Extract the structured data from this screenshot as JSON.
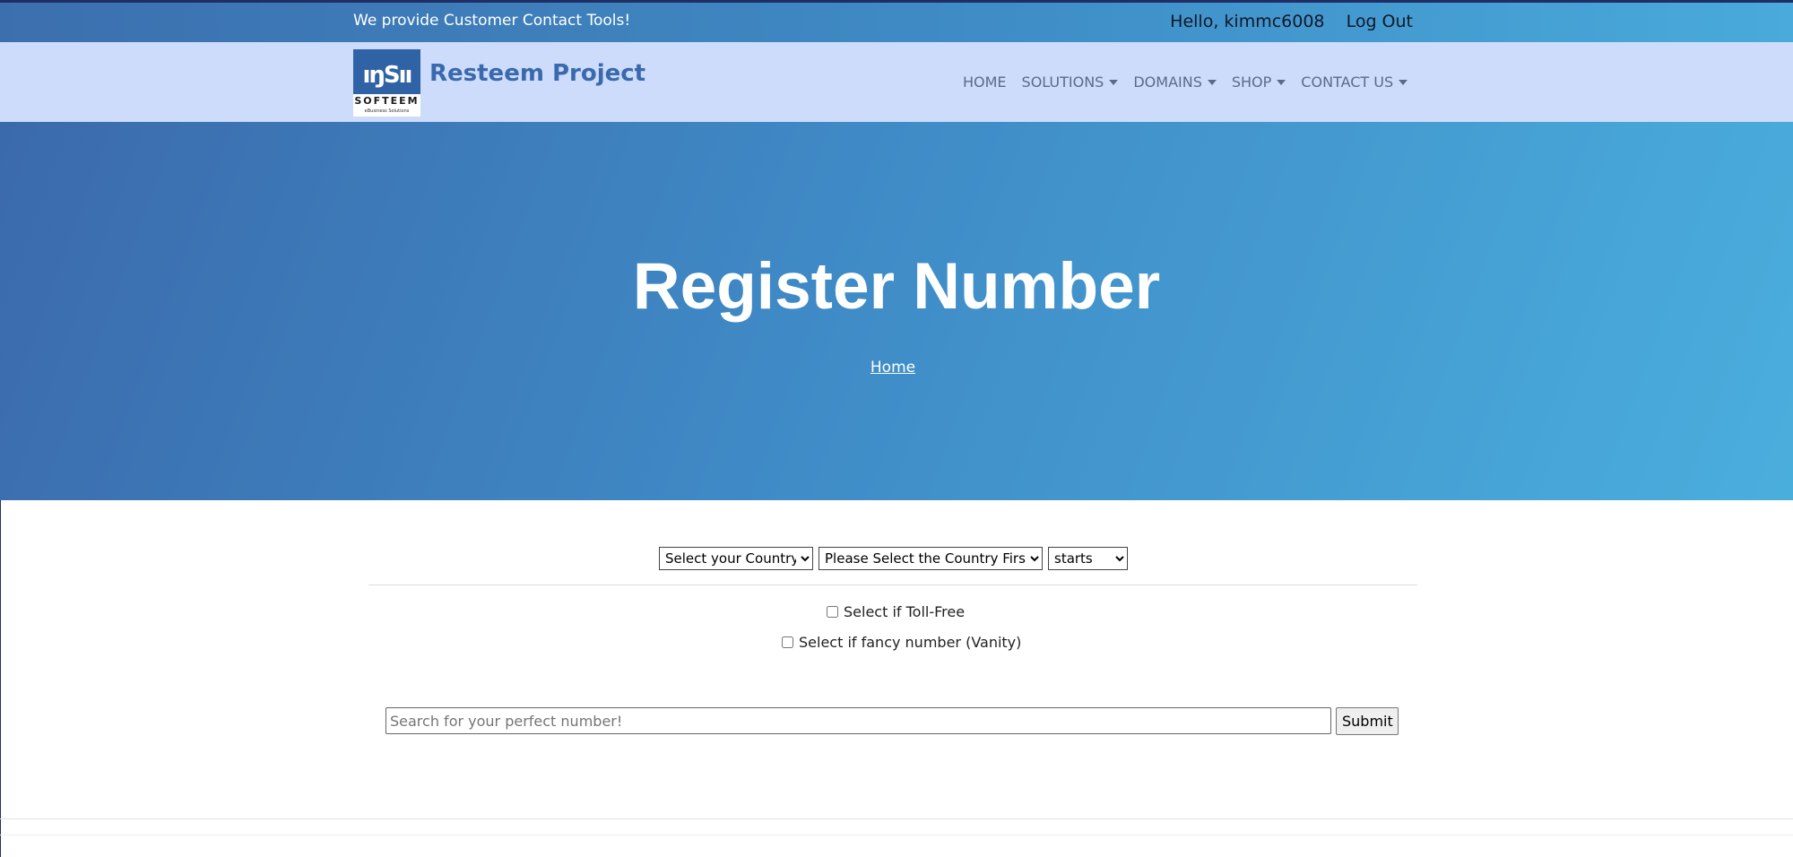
{
  "topbar": {
    "tagline": "We provide Customer Contact Tools!",
    "greeting": "Hello, kimmc6008",
    "logout": "Log Out"
  },
  "brand": {
    "logo_name": "SOFTEEM",
    "logo_sub": "eBusiness Solutions",
    "title": "Resteem Project"
  },
  "nav": {
    "items": [
      "HOME",
      "SOLUTIONS",
      "DOMAINS",
      "SHOP",
      "CONTACT US"
    ]
  },
  "hero": {
    "title": "Register Number",
    "breadcrumb": "Home"
  },
  "form": {
    "country_select": "Select your Country",
    "area_select": "Please Select the Country First",
    "match_select": "starts",
    "tollfree_label": "Select if Toll-Free",
    "vanity_label": "Select if fancy number (Vanity)",
    "search_placeholder": "Search for your perfect number!",
    "submit_label": "Submit"
  },
  "colors": {
    "accent": "#3a69ad",
    "navbar_bg": "#cddcfb",
    "hero_start": "#3b6aac",
    "hero_end": "#4aaedd"
  }
}
